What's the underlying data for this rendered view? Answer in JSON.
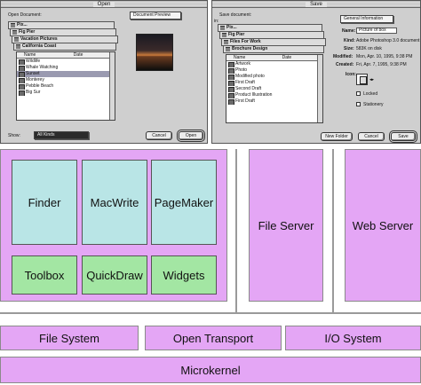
{
  "open_dialog": {
    "title": "Open",
    "label": "Open Document:",
    "preview_popup": "Document Preview",
    "folders": [
      "Pix...",
      "Fig Pier",
      "Vacation Pictures",
      "California Coast"
    ],
    "columns": [
      "Name",
      "Date"
    ],
    "files": [
      "Wildlife",
      "Whale Watching",
      "Sunset",
      "Monterey",
      "Pebble Beach",
      "Big Sur"
    ],
    "selected_file": "Sunset",
    "show_label": "Show:",
    "show_value": "All Kinds",
    "cancel_label": "Cancel",
    "open_label": "Open"
  },
  "save_dialog": {
    "title": "Save",
    "label": "Save document:",
    "in_label": "in:",
    "folders": [
      "Pix...",
      "Fig Pier",
      "Files For Work",
      "Brochure Design"
    ],
    "columns": [
      "Name",
      "Date"
    ],
    "files": [
      "Artwork",
      "Photo",
      "Modified photo",
      "First Draft",
      "Second Draft",
      "Product Illustration",
      "First Draft"
    ],
    "info_popup": "General Information",
    "info": [
      {
        "key": "Name:",
        "value": "Picture of box"
      },
      {
        "key": "Kind:",
        "value": "Adobe Photoshop 3.0 document"
      },
      {
        "key": "Size:",
        "value": "583K on disk"
      },
      {
        "key": "Modified:",
        "value": "Mon, Apr. 10, 1995, 9:38 PM"
      },
      {
        "key": "Created:",
        "value": "Fri, Apr. 7, 1995, 9:38 PM"
      },
      {
        "key": "Icon:",
        "value": ""
      }
    ],
    "locked_label": "Locked",
    "stationery_label": "Stationery",
    "new_folder_label": "New Folder",
    "cancel_label": "Cancel",
    "save_label": "Save"
  },
  "diagram": {
    "apps": [
      "Finder",
      "MacWrite",
      "PageMaker"
    ],
    "toolkits": [
      "Toolbox",
      "QuickDraw",
      "Widgets"
    ],
    "servers": [
      "File Server",
      "Web Server"
    ],
    "services": [
      "File System",
      "Open Transport",
      "I/O System"
    ],
    "kernel": "Microkernel",
    "colors": {
      "layer_fill": "#e4a6f5",
      "app_fill": "#b9e5e6",
      "toolkit_fill": "#a3e6a3"
    }
  }
}
